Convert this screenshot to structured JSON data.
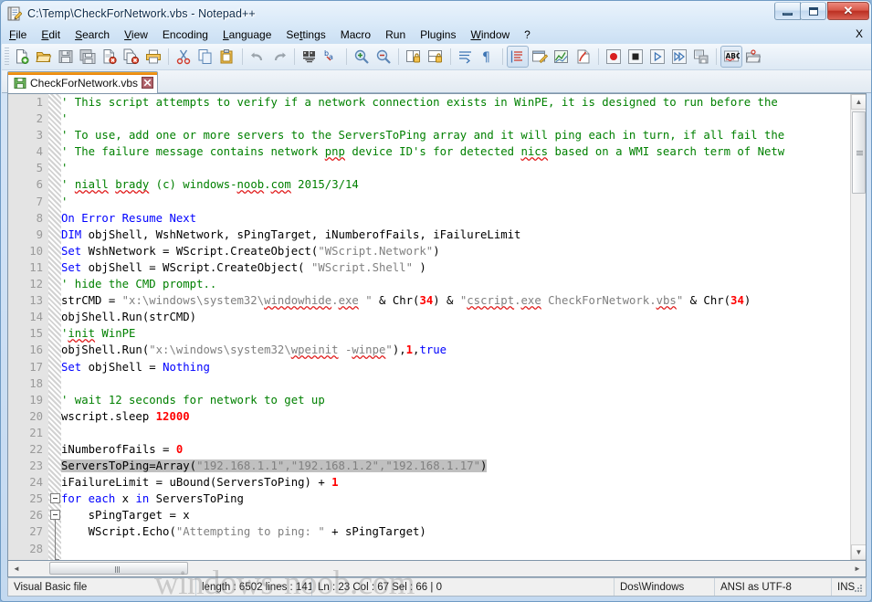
{
  "window": {
    "title": "C:\\Temp\\CheckForNetwork.vbs - Notepad++",
    "icon": "notepad-plus-plus-icon",
    "buttons": {
      "minimize": "minimize-button",
      "maximize": "maximize-button",
      "close_glyph": "✕"
    }
  },
  "menu": {
    "items": [
      {
        "label": "File",
        "accel": "F"
      },
      {
        "label": "Edit",
        "accel": "E"
      },
      {
        "label": "Search",
        "accel": "S"
      },
      {
        "label": "View",
        "accel": "V"
      },
      {
        "label": "Encoding",
        "accel": ""
      },
      {
        "label": "Language",
        "accel": "L"
      },
      {
        "label": "Settings",
        "accel": "t"
      },
      {
        "label": "Macro",
        "accel": ""
      },
      {
        "label": "Run",
        "accel": ""
      },
      {
        "label": "Plugins",
        "accel": ""
      },
      {
        "label": "Window",
        "accel": "W"
      },
      {
        "label": "?",
        "accel": ""
      }
    ],
    "close_doc_label": "X"
  },
  "toolbar": {
    "buttons": [
      "new-file-icon",
      "open-file-icon",
      "save-icon",
      "save-all-icon",
      "close-file-icon",
      "close-all-icon",
      "print-icon",
      "sep",
      "cut-icon",
      "copy-icon",
      "paste-icon",
      "sep",
      "undo-icon",
      "redo-icon",
      "sep",
      "find-icon",
      "replace-icon",
      "sep",
      "zoom-in-icon",
      "zoom-out-icon",
      "sep",
      "sync-vertical-scroll-icon",
      "sync-horizontal-scroll-icon",
      "sep",
      "word-wrap-icon",
      "show-all-characters-icon",
      "sep",
      "show-indent-guide-icon",
      "user-defined-dialog-icon",
      "show-document-map-icon",
      "function-list-icon",
      "sep",
      "macro-record-icon",
      "macro-stop-icon",
      "macro-play-icon",
      "macro-playback-multiple-icon",
      "macro-save-icon",
      "sep",
      "spell-check-icon",
      "folder-as-workspace-icon"
    ]
  },
  "tab": {
    "label": "CheckForNetwork.vbs",
    "save_icon": "save-state-icon",
    "close_icon": "tab-close-icon"
  },
  "editor": {
    "selected_line": 23,
    "colors": {
      "comment": "#008000",
      "keyword": "#0000ff",
      "string": "#808080",
      "number": "#ff0000",
      "plain": "#000000",
      "selection": "#c0c0c0",
      "line_number": "#9a9a9a",
      "margin_bg": "#e4e4e4"
    },
    "lines": [
      {
        "n": 1,
        "tokens": [
          {
            "t": "' This script attempts to verify if a network connection exists in WinPE, it is designed to run before the ",
            "c": "com"
          }
        ]
      },
      {
        "n": 2,
        "tokens": [
          {
            "t": "'",
            "c": "com"
          }
        ]
      },
      {
        "n": 3,
        "tokens": [
          {
            "t": "' To use, add one or more servers to the ServersToPing array and it will ping each in turn, if all fail the",
            "c": "com"
          }
        ]
      },
      {
        "n": 4,
        "tokens": [
          {
            "t": "' The failure message contains network ",
            "c": "com"
          },
          {
            "t": "pnp",
            "c": "com sp"
          },
          {
            "t": " device ID's for detected ",
            "c": "com"
          },
          {
            "t": "nics",
            "c": "com sp"
          },
          {
            "t": " based on a WMI search term of Netw",
            "c": "com"
          }
        ]
      },
      {
        "n": 5,
        "tokens": [
          {
            "t": "'",
            "c": "com"
          }
        ]
      },
      {
        "n": 6,
        "tokens": [
          {
            "t": "' ",
            "c": "com"
          },
          {
            "t": "niall",
            "c": "com sp"
          },
          {
            "t": " ",
            "c": "com"
          },
          {
            "t": "brady",
            "c": "com sp"
          },
          {
            "t": " (c) windows-",
            "c": "com"
          },
          {
            "t": "noob",
            "c": "com sp"
          },
          {
            "t": ".",
            "c": "com"
          },
          {
            "t": "com",
            "c": "com sp"
          },
          {
            "t": " 2015/3/14",
            "c": "com"
          }
        ]
      },
      {
        "n": 7,
        "tokens": [
          {
            "t": "'",
            "c": "com"
          }
        ]
      },
      {
        "n": 8,
        "tokens": [
          {
            "t": "On Error Resume Next",
            "c": "kw"
          }
        ]
      },
      {
        "n": 9,
        "tokens": [
          {
            "t": "DIM",
            "c": "kw"
          },
          {
            "t": " objShell, WshNetwork, sPingTarget, iNumberofFails, iFailureLimit",
            "c": "plain"
          }
        ]
      },
      {
        "n": 10,
        "tokens": [
          {
            "t": "Set",
            "c": "kw"
          },
          {
            "t": " WshNetwork = WScript.CreateObject(",
            "c": "plain"
          },
          {
            "t": "\"WScript.Network\"",
            "c": "str"
          },
          {
            "t": ")",
            "c": "plain"
          }
        ]
      },
      {
        "n": 11,
        "tokens": [
          {
            "t": "Set",
            "c": "kw"
          },
          {
            "t": " objShell = WScript.CreateObject( ",
            "c": "plain"
          },
          {
            "t": "\"WScript.Shell\"",
            "c": "str"
          },
          {
            "t": " )",
            "c": "plain"
          }
        ]
      },
      {
        "n": 12,
        "tokens": [
          {
            "t": "' hide the CMD prompt..",
            "c": "com"
          }
        ]
      },
      {
        "n": 13,
        "tokens": [
          {
            "t": "strCMD = ",
            "c": "plain"
          },
          {
            "t": "\"x:\\windows\\system32\\",
            "c": "str"
          },
          {
            "t": "windowhide",
            "c": "str sp"
          },
          {
            "t": ".",
            "c": "str"
          },
          {
            "t": "exe",
            "c": "str sp"
          },
          {
            "t": " \"",
            "c": "str"
          },
          {
            "t": " & Chr(",
            "c": "plain"
          },
          {
            "t": "34",
            "c": "num"
          },
          {
            "t": ") & ",
            "c": "plain"
          },
          {
            "t": "\"",
            "c": "str"
          },
          {
            "t": "cscript",
            "c": "str sp"
          },
          {
            "t": ".",
            "c": "str"
          },
          {
            "t": "exe",
            "c": "str sp"
          },
          {
            "t": " CheckForNetwork.",
            "c": "str"
          },
          {
            "t": "vbs",
            "c": "str sp"
          },
          {
            "t": "\"",
            "c": "str"
          },
          {
            "t": " & Chr(",
            "c": "plain"
          },
          {
            "t": "34",
            "c": "num"
          },
          {
            "t": ")",
            "c": "plain"
          }
        ]
      },
      {
        "n": 14,
        "tokens": [
          {
            "t": "objShell.Run(strCMD)",
            "c": "plain"
          }
        ]
      },
      {
        "n": 15,
        "tokens": [
          {
            "t": "'",
            "c": "com"
          },
          {
            "t": "init",
            "c": "com sp"
          },
          {
            "t": " WinPE",
            "c": "com"
          }
        ]
      },
      {
        "n": 16,
        "tokens": [
          {
            "t": "objShell.Run(",
            "c": "plain"
          },
          {
            "t": "\"x:\\windows\\system32\\",
            "c": "str"
          },
          {
            "t": "wpeinit",
            "c": "str sp"
          },
          {
            "t": " -",
            "c": "str"
          },
          {
            "t": "winpe",
            "c": "str sp"
          },
          {
            "t": "\"",
            "c": "str"
          },
          {
            "t": "),",
            "c": "plain"
          },
          {
            "t": "1",
            "c": "num"
          },
          {
            "t": ",",
            "c": "plain"
          },
          {
            "t": "true",
            "c": "kw"
          }
        ]
      },
      {
        "n": 17,
        "tokens": [
          {
            "t": "Set",
            "c": "kw"
          },
          {
            "t": " objShell = ",
            "c": "plain"
          },
          {
            "t": "Nothing",
            "c": "kw"
          }
        ]
      },
      {
        "n": 18,
        "tokens": [
          {
            "t": "",
            "c": "plain"
          }
        ]
      },
      {
        "n": 19,
        "tokens": [
          {
            "t": "' wait 12 seconds for network to get up",
            "c": "com"
          }
        ]
      },
      {
        "n": 20,
        "tokens": [
          {
            "t": "wscript.sleep ",
            "c": "plain"
          },
          {
            "t": "12000",
            "c": "num"
          }
        ]
      },
      {
        "n": 21,
        "tokens": [
          {
            "t": "",
            "c": "plain"
          }
        ]
      },
      {
        "n": 22,
        "tokens": [
          {
            "t": "iNumberofFails = ",
            "c": "plain"
          },
          {
            "t": "0",
            "c": "num"
          }
        ]
      },
      {
        "n": 23,
        "tokens": [
          {
            "t": "ServersToPing=Array(",
            "c": "plain"
          },
          {
            "t": "\"192.168.1.1\",\"192.168.1.2\",\"192.168.1.17\"",
            "c": "str"
          },
          {
            "t": ")",
            "c": "plain"
          }
        ]
      },
      {
        "n": 24,
        "tokens": [
          {
            "t": "iFailureLimit = uBound(ServersToPing) + ",
            "c": "plain"
          },
          {
            "t": "1",
            "c": "num"
          }
        ]
      },
      {
        "n": 25,
        "tokens": [
          {
            "t": "for each",
            "c": "kw"
          },
          {
            "t": " x ",
            "c": "plain"
          },
          {
            "t": "in",
            "c": "kw"
          },
          {
            "t": " ServersToPing",
            "c": "plain"
          }
        ]
      },
      {
        "n": 26,
        "tokens": [
          {
            "t": "    sPingTarget = x",
            "c": "plain"
          }
        ]
      },
      {
        "n": 27,
        "tokens": [
          {
            "t": "    WScript.Echo(",
            "c": "plain"
          },
          {
            "t": "\"Attempting to ping: \"",
            "c": "str"
          },
          {
            "t": " + sPingTarget)",
            "c": "plain"
          }
        ]
      },
      {
        "n": 28,
        "tokens": [
          {
            "t": "",
            "c": "plain"
          }
        ]
      }
    ]
  },
  "scrollbars": {
    "v_up": "▲",
    "v_down": "▼",
    "h_left": "◄",
    "h_right": "►"
  },
  "statusbar": {
    "doc_type": "Visual Basic file",
    "length_lines": "length : 6502    lines : 141",
    "position": "Ln : 23    Col : 67    Sel : 66 | 0",
    "eol": "Dos\\Windows",
    "encoding": "ANSI as UTF-8",
    "insert_mode": "INS"
  },
  "watermark": {
    "text": "windows-noob.com"
  }
}
